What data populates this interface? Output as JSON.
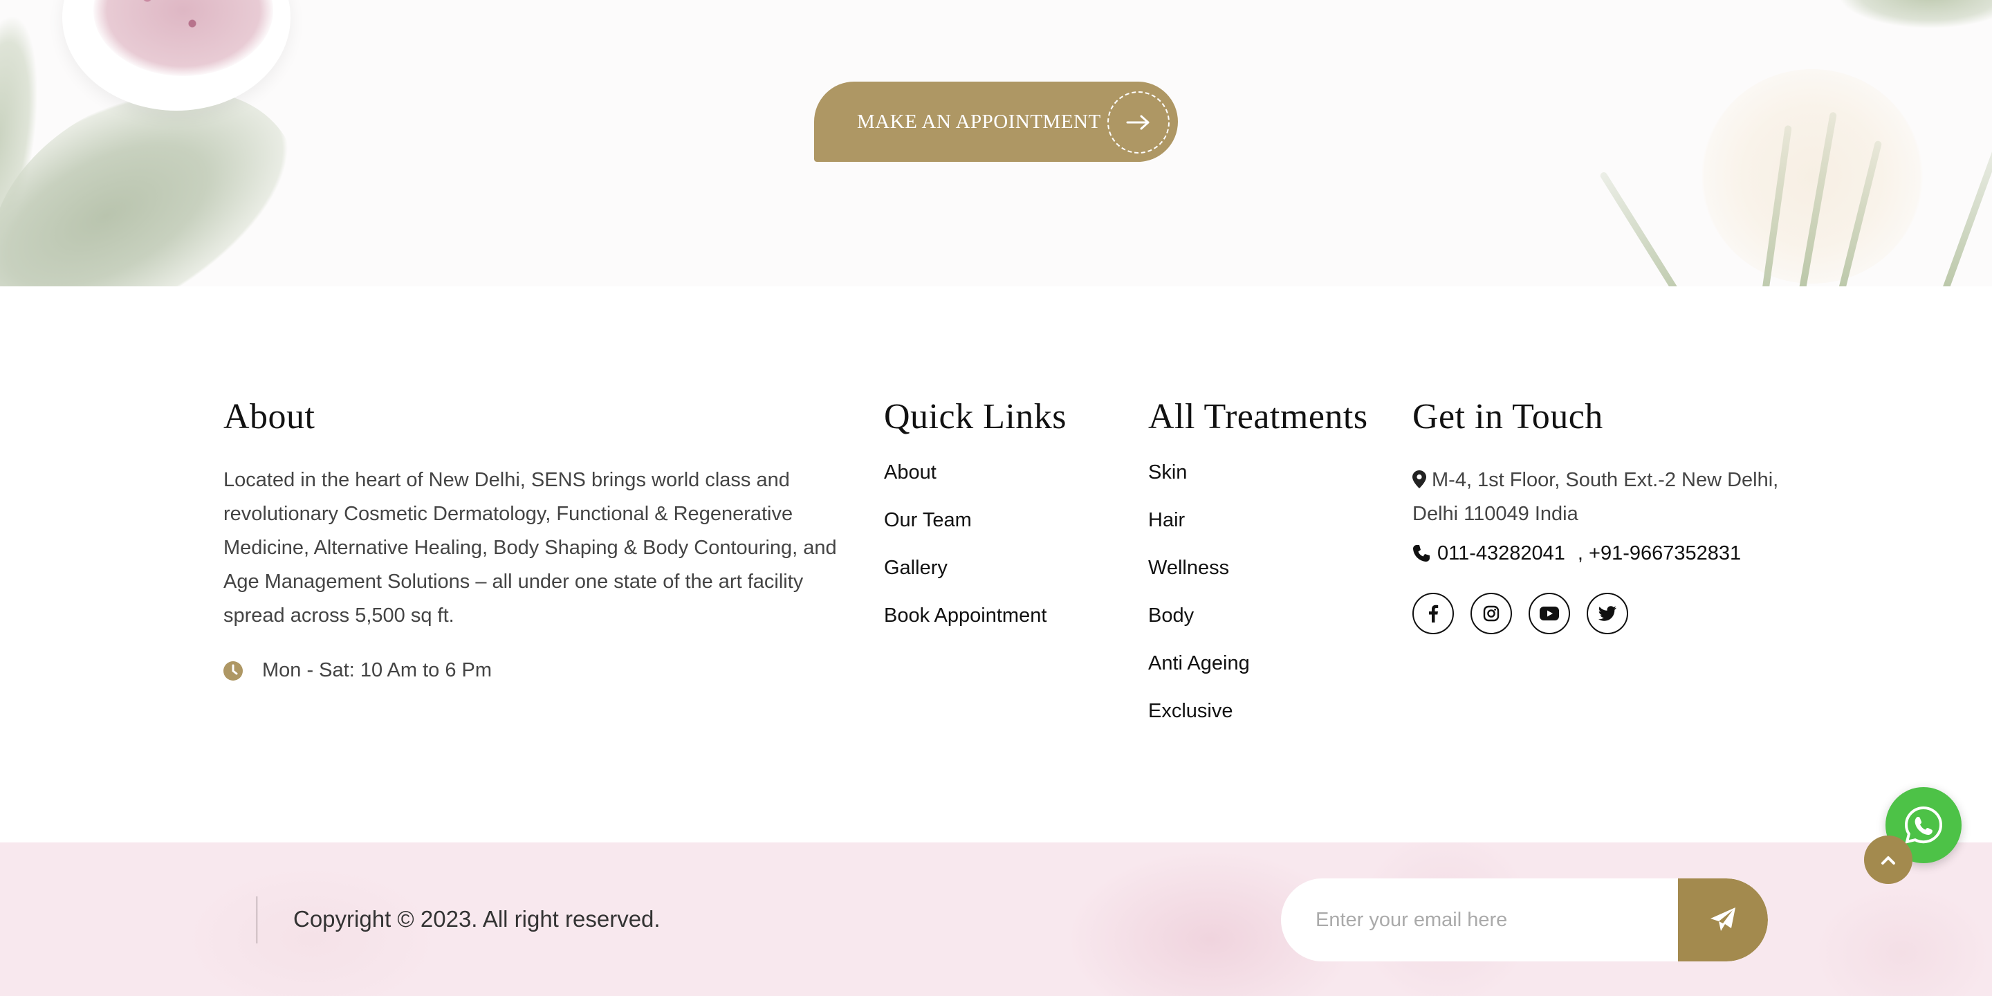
{
  "hero": {
    "appointment_label": "MAKE AN APPOINTMENT"
  },
  "about": {
    "heading": "About",
    "description": "Located in the heart of New Delhi, SENS brings world class and revolutionary Cosmetic Dermatology, Functional & Regenerative Medicine, Alternative Healing, Body Shaping & Body Contouring, and Age Management Solutions – all under one state of the art facility spread across 5,500 sq ft.",
    "hours": "Mon - Sat: 10 Am to 6 Pm"
  },
  "quick_links": {
    "heading": "Quick Links",
    "items": [
      "About",
      "Our Team",
      "Gallery",
      "Book Appointment"
    ]
  },
  "treatments": {
    "heading": "All Treatments",
    "items": [
      "Skin",
      "Hair",
      "Wellness",
      "Body",
      "Anti Ageing",
      "Exclusive"
    ]
  },
  "contact": {
    "heading": "Get in Touch",
    "address": "M-4, 1st Floor, South Ext.-2 New Delhi, Delhi 110049 India",
    "phone1": "011-43282041",
    "phone2": ", +91-9667352831",
    "social": [
      "facebook",
      "instagram",
      "youtube",
      "twitter"
    ]
  },
  "footer": {
    "copyright": "Copyright © 2023. All right reserved.",
    "email_placeholder": "Enter your email here"
  },
  "colors": {
    "accent": "#ae9764",
    "footer_bg": "#f8e8ee",
    "whatsapp": "#4dc247"
  }
}
